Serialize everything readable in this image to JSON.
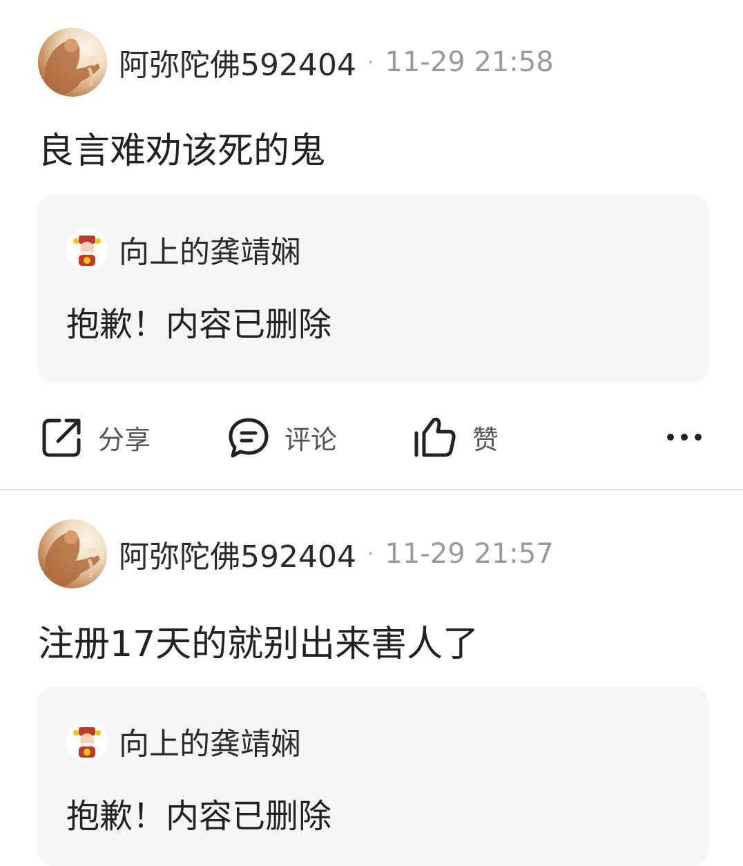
{
  "posts": [
    {
      "author": "阿弥陀佛592404",
      "separator": "·",
      "time": "11-29 21:58",
      "content": "良言难劝该死的鬼",
      "quote": {
        "author": "向上的龚靖娴",
        "text": "抱歉！内容已删除"
      },
      "actions": {
        "share": "分享",
        "comment": "评论",
        "like": "赞",
        "more": "···"
      }
    },
    {
      "author": "阿弥陀佛592404",
      "separator": "·",
      "time": "11-29 21:57",
      "content": "注册17天的就别出来害人了",
      "quote": {
        "author": "向上的龚靖娴",
        "text": "抱歉！内容已删除"
      }
    }
  ],
  "icons": {
    "share": "share-icon",
    "comment": "comment-icon",
    "like": "thumbs-up-icon",
    "more": "more-icon"
  }
}
